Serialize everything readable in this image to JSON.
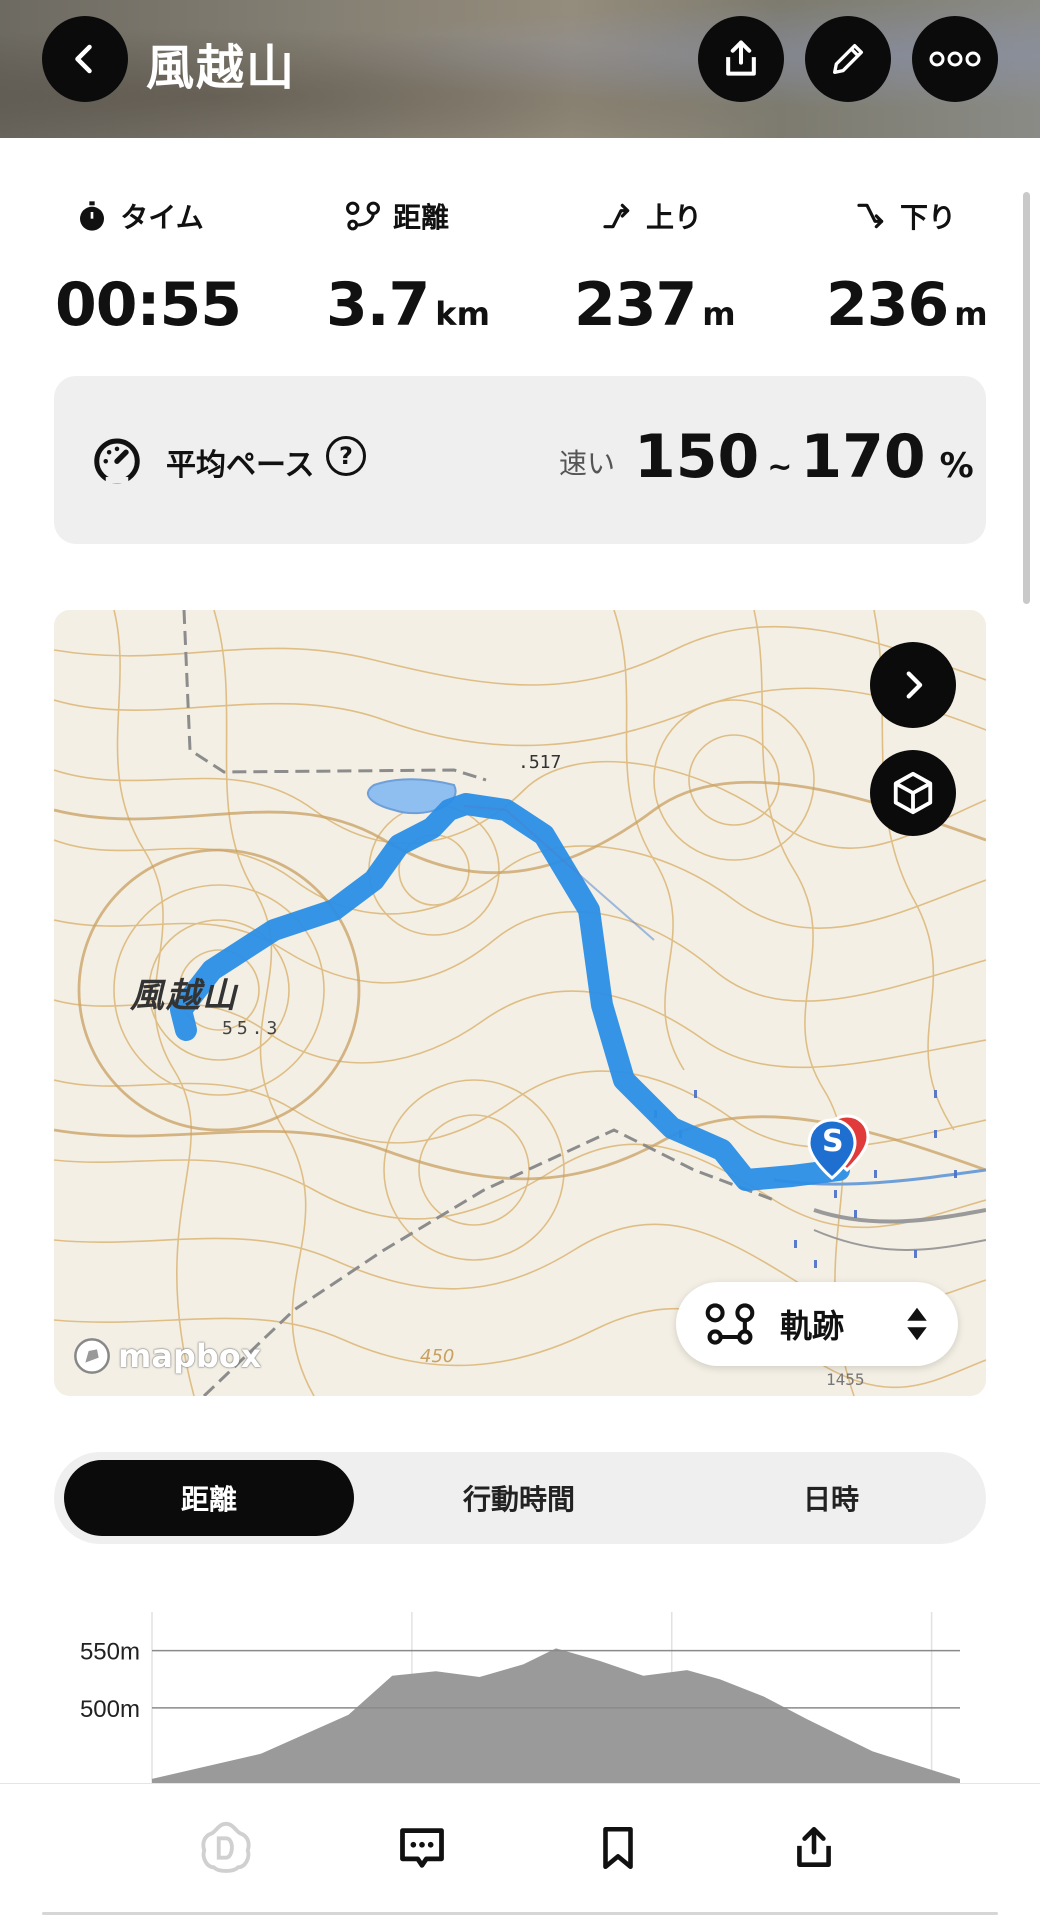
{
  "header": {
    "title": "風越山"
  },
  "stats": [
    {
      "label": "タイム",
      "value": "00:55",
      "unit": "",
      "icon": "stopwatch-icon"
    },
    {
      "label": "距離",
      "value": "3.7",
      "unit": "km",
      "icon": "route-icon"
    },
    {
      "label": "上り",
      "value": "237",
      "unit": "m",
      "icon": "ascent-icon"
    },
    {
      "label": "下り",
      "value": "236",
      "unit": "m",
      "icon": "descent-icon"
    }
  ],
  "pace": {
    "label": "平均ペース",
    "qualifier": "速い",
    "min": "150",
    "tilde": "~",
    "max": "170",
    "unit": "%"
  },
  "map": {
    "peak_name": "風越山",
    "peak_elevation": "55.3",
    "contour_label_top": ".517",
    "contour_label_bottom": "450",
    "contour_label_right": "1455",
    "start_marker": "S",
    "attribution": "mapbox",
    "track_button_label": "軌跡",
    "colors": {
      "track": "#2b8ee6",
      "contour": "#d9b06a",
      "water": "#8fbff0"
    }
  },
  "tabs": [
    {
      "label": "距離",
      "active": true
    },
    {
      "label": "行動時間",
      "active": false
    },
    {
      "label": "日時",
      "active": false
    }
  ],
  "chart_data": {
    "type": "area",
    "ylabel": "",
    "ytick_labels": [
      "550m",
      "500m"
    ],
    "yticks": [
      550,
      500
    ],
    "ylim": [
      430,
      575
    ],
    "x": [
      0.0,
      0.5,
      0.9,
      1.1,
      1.3,
      1.5,
      1.7,
      1.85,
      2.05,
      2.25,
      2.45,
      2.6,
      2.8,
      3.0,
      3.3,
      3.7
    ],
    "y": [
      438,
      460,
      494,
      528,
      532,
      527,
      538,
      552,
      541,
      528,
      533,
      525,
      510,
      490,
      462,
      438
    ],
    "grid": true,
    "fill_color": "#9a9a9a"
  },
  "bottom_bar": [
    {
      "icon": "dolomite-logo-icon"
    },
    {
      "icon": "comment-icon"
    },
    {
      "icon": "bookmark-icon"
    },
    {
      "icon": "share-icon"
    }
  ]
}
